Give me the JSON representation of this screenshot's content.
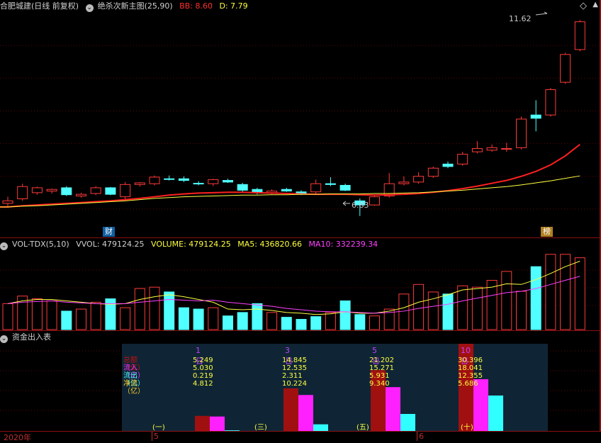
{
  "main_header": {
    "stock_name": "合肥城建(日线 前复权)",
    "indicator": "绝杀次新主图(25,90)",
    "bb_label": "BB: 8.60",
    "d_label": "D: 7.79",
    "colors": {
      "stock": "#d0d0d0",
      "indicator": "#d0d0d0",
      "bb": "#ff3030",
      "d": "#ffff40"
    }
  },
  "price_labels": {
    "high": "11.62",
    "low": "6.83"
  },
  "markers": {
    "cai": "财",
    "bang": "榜"
  },
  "window_controls": {
    "diamond_icon": "◇",
    "up_icon": "▲"
  },
  "vol_header": {
    "title": "VOL-TDX(5,10)",
    "vvol": "VVOL: 479124.25",
    "volume": "VOLUME: 479124.25",
    "ma5": "MA5: 436820.66",
    "ma10": "MA10: 332239.34",
    "colors": {
      "volume": "#ffff40",
      "ma5": "#ffff40",
      "ma10": "#ff40ff"
    }
  },
  "fund_header": {
    "title": "资金出入表"
  },
  "fund_table": {
    "row_labels": [
      "总额（亿）",
      "流入（亿）",
      "流出（亿）",
      "净流（亿）"
    ],
    "row_colors": [
      "#c01010",
      "#ff30ff",
      "#40ffff",
      "#ffd030"
    ],
    "periods": [
      {
        "title": "1日",
        "values": [
          "5.249",
          "5.030",
          "0.219",
          "4.812"
        ],
        "tag": "(一)"
      },
      {
        "title": "3日",
        "values": [
          "14.845",
          "12.535",
          "2.311",
          "10.224"
        ],
        "tag": "(三)"
      },
      {
        "title": "5日",
        "values": [
          "21.202",
          "15.271",
          "5.931",
          "9.340"
        ],
        "tag": "(五)"
      },
      {
        "title": "10日",
        "values": [
          "30.396",
          "18.041",
          "12.355",
          "5.686"
        ],
        "tag": "(十)"
      }
    ]
  },
  "time_axis": {
    "year": "2020年",
    "month5": "5",
    "month6": "6"
  },
  "chart_data": [
    {
      "type": "candlestick",
      "title": "绝杀次新主图(25,90)",
      "note": "daily candles, OHLC in price units",
      "candles": [
        {
          "o": 7.2,
          "h": 7.3,
          "l": 7.05,
          "c": 7.14,
          "up": true
        },
        {
          "o": 7.25,
          "h": 7.62,
          "l": 7.2,
          "c": 7.55,
          "up": true
        },
        {
          "o": 7.4,
          "h": 7.55,
          "l": 7.35,
          "c": 7.52,
          "up": true
        },
        {
          "o": 7.44,
          "h": 7.5,
          "l": 7.38,
          "c": 7.48,
          "up": true
        },
        {
          "o": 7.52,
          "h": 7.56,
          "l": 7.32,
          "c": 7.35,
          "up": false
        },
        {
          "o": 7.32,
          "h": 7.4,
          "l": 7.28,
          "c": 7.36,
          "up": true
        },
        {
          "o": 7.38,
          "h": 7.56,
          "l": 7.34,
          "c": 7.52,
          "up": true
        },
        {
          "o": 7.52,
          "h": 7.54,
          "l": 7.34,
          "c": 7.36,
          "up": false
        },
        {
          "o": 7.3,
          "h": 7.66,
          "l": 7.2,
          "c": 7.6,
          "up": true
        },
        {
          "o": 7.6,
          "h": 7.66,
          "l": 7.55,
          "c": 7.64,
          "up": true
        },
        {
          "o": 7.62,
          "h": 7.82,
          "l": 7.58,
          "c": 7.78,
          "up": true
        },
        {
          "o": 7.74,
          "h": 7.82,
          "l": 7.7,
          "c": 7.74,
          "up": false
        },
        {
          "o": 7.74,
          "h": 7.8,
          "l": 7.66,
          "c": 7.7,
          "up": false
        },
        {
          "o": 7.62,
          "h": 7.68,
          "l": 7.58,
          "c": 7.63,
          "up": false
        },
        {
          "o": 7.62,
          "h": 7.74,
          "l": 7.56,
          "c": 7.72,
          "up": true
        },
        {
          "o": 7.7,
          "h": 7.74,
          "l": 7.64,
          "c": 7.66,
          "up": false
        },
        {
          "o": 7.6,
          "h": 7.64,
          "l": 7.42,
          "c": 7.46,
          "up": false
        },
        {
          "o": 7.48,
          "h": 7.52,
          "l": 7.36,
          "c": 7.4,
          "up": false
        },
        {
          "o": 7.4,
          "h": 7.48,
          "l": 7.36,
          "c": 7.44,
          "up": true
        },
        {
          "o": 7.48,
          "h": 7.52,
          "l": 7.42,
          "c": 7.44,
          "up": false
        },
        {
          "o": 7.42,
          "h": 7.46,
          "l": 7.34,
          "c": 7.36,
          "up": false
        },
        {
          "o": 7.42,
          "h": 7.72,
          "l": 7.38,
          "c": 7.62,
          "up": true
        },
        {
          "o": 7.62,
          "h": 7.78,
          "l": 7.56,
          "c": 7.6,
          "up": false
        },
        {
          "o": 7.58,
          "h": 7.62,
          "l": 7.44,
          "c": 7.46,
          "up": false
        },
        {
          "o": 7.2,
          "h": 7.26,
          "l": 6.83,
          "c": 7.1,
          "up": false
        },
        {
          "o": 7.1,
          "h": 7.32,
          "l": 7.08,
          "c": 7.3,
          "up": true
        },
        {
          "o": 7.32,
          "h": 7.88,
          "l": 7.28,
          "c": 7.62,
          "up": true
        },
        {
          "o": 7.62,
          "h": 7.8,
          "l": 7.58,
          "c": 7.66,
          "up": true
        },
        {
          "o": 7.66,
          "h": 7.9,
          "l": 7.62,
          "c": 7.8,
          "up": true
        },
        {
          "o": 7.8,
          "h": 8.04,
          "l": 7.76,
          "c": 8.0,
          "up": true
        },
        {
          "o": 8.04,
          "h": 8.16,
          "l": 8.0,
          "c": 8.1,
          "up": false
        },
        {
          "o": 8.1,
          "h": 8.4,
          "l": 8.06,
          "c": 8.34,
          "up": true
        },
        {
          "o": 8.4,
          "h": 8.66,
          "l": 8.36,
          "c": 8.48,
          "up": true
        },
        {
          "o": 8.44,
          "h": 8.58,
          "l": 8.4,
          "c": 8.5,
          "up": true
        },
        {
          "o": 8.46,
          "h": 8.62,
          "l": 8.4,
          "c": 8.48,
          "up": true
        },
        {
          "o": 8.5,
          "h": 9.26,
          "l": 8.46,
          "c": 9.2,
          "up": true
        },
        {
          "o": 9.22,
          "h": 9.66,
          "l": 8.9,
          "c": 9.3,
          "up": false
        },
        {
          "o": 9.3,
          "h": 9.96,
          "l": 9.26,
          "c": 9.92,
          "up": true
        },
        {
          "o": 10.1,
          "h": 10.82,
          "l": 10.06,
          "c": 10.78,
          "up": true
        },
        {
          "o": 10.9,
          "h": 11.62,
          "l": 10.86,
          "c": 11.58,
          "up": true
        }
      ],
      "yrange": [
        6.6,
        11.8
      ],
      "series": [
        {
          "name": "BB",
          "color": "#ff2020",
          "values": [
            7.05,
            7.08,
            7.1,
            7.12,
            7.14,
            7.16,
            7.18,
            7.2,
            7.23,
            7.26,
            7.3,
            7.34,
            7.37,
            7.39,
            7.4,
            7.41,
            7.41,
            7.4,
            7.39,
            7.38,
            7.37,
            7.36,
            7.36,
            7.36,
            7.35,
            7.34,
            7.35,
            7.36,
            7.38,
            7.41,
            7.45,
            7.5,
            7.56,
            7.63,
            7.7,
            7.8,
            7.92,
            8.08,
            8.3,
            8.58
          ]
        },
        {
          "name": "D",
          "color": "#ffff40",
          "values": [
            7.05,
            7.07,
            7.08,
            7.1,
            7.12,
            7.14,
            7.16,
            7.18,
            7.2,
            7.23,
            7.26,
            7.28,
            7.3,
            7.31,
            7.32,
            7.33,
            7.34,
            7.34,
            7.35,
            7.35,
            7.36,
            7.36,
            7.37,
            7.37,
            7.37,
            7.38,
            7.38,
            7.39,
            7.4,
            7.42,
            7.44,
            7.46,
            7.49,
            7.52,
            7.55,
            7.59,
            7.64,
            7.69,
            7.75,
            7.81
          ]
        }
      ]
    },
    {
      "type": "bar",
      "title": "VOL-TDX(5,10)",
      "values": [
        0.38,
        0.49,
        0.45,
        0.42,
        0.27,
        0.3,
        0.4,
        0.45,
        0.32,
        0.6,
        0.62,
        0.55,
        0.32,
        0.3,
        0.32,
        0.2,
        0.25,
        0.38,
        0.25,
        0.18,
        0.15,
        0.19,
        0.25,
        0.42,
        0.22,
        0.2,
        0.3,
        0.52,
        0.66,
        0.55,
        0.52,
        0.64,
        0.62,
        0.72,
        0.85,
        0.56,
        0.92,
        1.1,
        1.1,
        1.05
      ],
      "up": [
        true,
        true,
        true,
        true,
        false,
        true,
        true,
        false,
        true,
        true,
        true,
        false,
        false,
        false,
        true,
        false,
        false,
        false,
        true,
        false,
        false,
        false,
        true,
        false,
        false,
        true,
        true,
        true,
        true,
        true,
        false,
        true,
        true,
        true,
        true,
        true,
        false,
        true,
        true,
        true
      ],
      "series": [
        {
          "name": "MA5",
          "color": "#ffff40",
          "values": [
            0.38,
            0.42,
            0.44,
            0.44,
            0.42,
            0.4,
            0.38,
            0.37,
            0.38,
            0.44,
            0.48,
            0.51,
            0.48,
            0.44,
            0.4,
            0.3,
            0.29,
            0.3,
            0.28,
            0.25,
            0.24,
            0.22,
            0.23,
            0.26,
            0.24,
            0.24,
            0.27,
            0.32,
            0.4,
            0.45,
            0.51,
            0.58,
            0.6,
            0.62,
            0.67,
            0.66,
            0.73,
            0.82,
            0.92,
            1.0
          ]
        },
        {
          "name": "MA10",
          "color": "#ff40ff",
          "values": [
            0.38,
            0.4,
            0.41,
            0.42,
            0.4,
            0.39,
            0.38,
            0.38,
            0.38,
            0.4,
            0.42,
            0.44,
            0.43,
            0.42,
            0.43,
            0.4,
            0.38,
            0.36,
            0.34,
            0.31,
            0.29,
            0.27,
            0.26,
            0.26,
            0.25,
            0.24,
            0.25,
            0.27,
            0.31,
            0.34,
            0.37,
            0.42,
            0.46,
            0.5,
            0.54,
            0.56,
            0.6,
            0.66,
            0.72,
            0.78
          ]
        }
      ]
    },
    {
      "type": "bar",
      "title": "资金出入表",
      "categories": [
        "1日",
        "3日",
        "5日",
        "10日"
      ],
      "series": [
        {
          "name": "总额",
          "color": "#a01010",
          "values": [
            5.249,
            14.845,
            21.202,
            30.396
          ]
        },
        {
          "name": "流入",
          "color": "#ff20ff",
          "values": [
            5.03,
            12.535,
            15.271,
            18.041
          ]
        },
        {
          "name": "流出",
          "color": "#30ffff",
          "values": [
            0.219,
            2.311,
            5.931,
            12.355
          ]
        }
      ]
    }
  ]
}
